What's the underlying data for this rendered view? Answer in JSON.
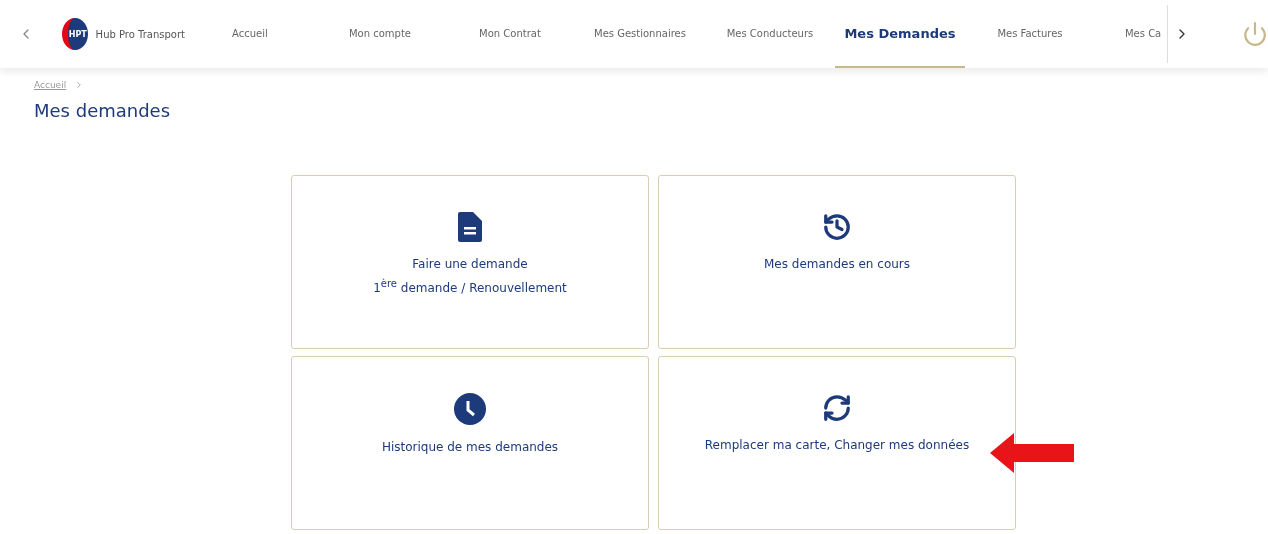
{
  "nav": {
    "logo": "HPT",
    "brand": "Hub Pro Transport",
    "tabs": [
      {
        "label": "Accueil",
        "selected": false
      },
      {
        "label": "Mon compte",
        "selected": false
      },
      {
        "label": "Mon Contrat",
        "selected": false
      },
      {
        "label": "Mes Gestionnaires",
        "selected": false
      },
      {
        "label": "Mes Conducteurs",
        "selected": false
      },
      {
        "label": "Mes Demandes",
        "selected": true
      },
      {
        "label": "Mes Factures",
        "selected": false
      },
      {
        "label": "Mes Ca",
        "selected": false
      }
    ]
  },
  "breadcrumb": [
    {
      "label": "Accueil"
    }
  ],
  "page_title": "Mes demandes",
  "cards": [
    {
      "kind": "document",
      "lines": [
        "Faire une demande",
        "1$^{ère}$ demande / Renouvellement"
      ],
      "highlighted": false
    },
    {
      "kind": "history",
      "lines": [
        "Mes demandes en cours"
      ],
      "highlighted": false
    },
    {
      "kind": "clock",
      "lines": [
        "Historique de mes demandes"
      ],
      "highlighted": false
    },
    {
      "kind": "refresh",
      "lines": [
        "Remplacer ma carte, Changer mes données"
      ],
      "highlighted": true
    }
  ]
}
